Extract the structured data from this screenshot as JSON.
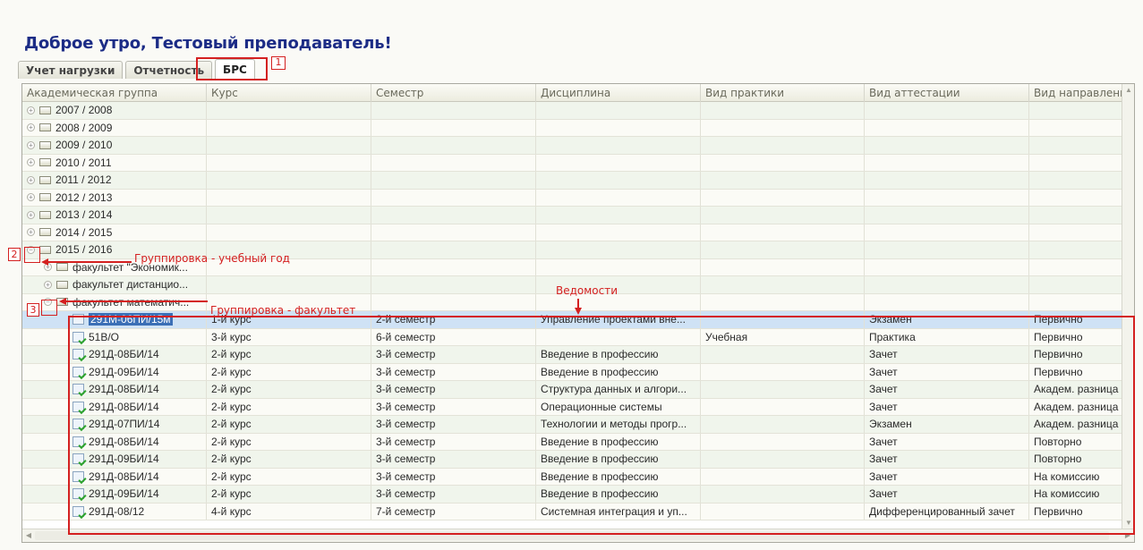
{
  "greeting": "Доброе утро, Тестовый преподаватель!",
  "tabs": [
    {
      "label": "Учет нагрузки",
      "active": false
    },
    {
      "label": "Отчетность",
      "active": false
    },
    {
      "label": "БРС",
      "active": true
    }
  ],
  "columns": [
    "Академическая группа",
    "Курс",
    "Семестр",
    "Дисциплина",
    "Вид практики",
    "Вид аттестации",
    "Вид направления"
  ],
  "year_rows": [
    "2007 / 2008",
    "2008 / 2009",
    "2009 / 2010",
    "2010 / 2011",
    "2011 / 2012",
    "2012 / 2013",
    "2013 / 2014",
    "2014 / 2015"
  ],
  "expanded_year": "2015 / 2016",
  "faculties": [
    "факультет \"Экономик...",
    "факультет дистанцио...",
    "факультет математич..."
  ],
  "records": [
    {
      "group": "291М-06ПИ/15м",
      "course": "1-й курс",
      "semester": "2-й семестр",
      "discipline": "Управление проектами вне...",
      "practice": "",
      "attestation": "Экзамен",
      "direction": "Первично"
    },
    {
      "group": "51В/О",
      "course": "3-й курс",
      "semester": "6-й семестр",
      "discipline": "",
      "practice": "Учебная",
      "attestation": "Практика",
      "direction": "Первично"
    },
    {
      "group": "291Д-08БИ/14",
      "course": "2-й курс",
      "semester": "3-й семестр",
      "discipline": "Введение в профессию",
      "practice": "",
      "attestation": "Зачет",
      "direction": "Первично"
    },
    {
      "group": "291Д-09БИ/14",
      "course": "2-й курс",
      "semester": "3-й семестр",
      "discipline": "Введение в профессию",
      "practice": "",
      "attestation": "Зачет",
      "direction": "Первично"
    },
    {
      "group": "291Д-08БИ/14",
      "course": "2-й курс",
      "semester": "3-й семестр",
      "discipline": "Структура данных и алгори...",
      "practice": "",
      "attestation": "Зачет",
      "direction": "Академ. разница"
    },
    {
      "group": "291Д-08БИ/14",
      "course": "2-й курс",
      "semester": "3-й семестр",
      "discipline": "Операционные системы",
      "practice": "",
      "attestation": "Зачет",
      "direction": "Академ. разница"
    },
    {
      "group": "291Д-07ПИ/14",
      "course": "2-й курс",
      "semester": "3-й семестр",
      "discipline": "Технологии и методы прогр...",
      "practice": "",
      "attestation": "Экзамен",
      "direction": "Академ. разница"
    },
    {
      "group": "291Д-08БИ/14",
      "course": "2-й курс",
      "semester": "3-й семестр",
      "discipline": "Введение в профессию",
      "practice": "",
      "attestation": "Зачет",
      "direction": "Повторно"
    },
    {
      "group": "291Д-09БИ/14",
      "course": "2-й курс",
      "semester": "3-й семестр",
      "discipline": "Введение в профессию",
      "practice": "",
      "attestation": "Зачет",
      "direction": "Повторно"
    },
    {
      "group": "291Д-08БИ/14",
      "course": "2-й курс",
      "semester": "3-й семестр",
      "discipline": "Введение в профессию",
      "practice": "",
      "attestation": "Зачет",
      "direction": "На комиссию"
    },
    {
      "group": "291Д-09БИ/14",
      "course": "2-й курс",
      "semester": "3-й семестр",
      "discipline": "Введение в профессию",
      "practice": "",
      "attestation": "Зачет",
      "direction": "На комиссию"
    },
    {
      "group": "291Д-08/12",
      "course": "4-й курс",
      "semester": "7-й семестр",
      "discipline": "Системная интеграция и уп...",
      "practice": "",
      "attestation": "Дифференцированный зачет",
      "direction": "Первично"
    }
  ],
  "annotations": {
    "tab_marker": "1",
    "year_marker": "2",
    "faculty_marker": "3",
    "year_grouping": "Группировка - учебный год",
    "faculty_grouping": "Группировка - факультет",
    "statements": "Ведомости"
  },
  "colors": {
    "annotation": "#d42020",
    "greeting": "#1c2c86",
    "selected_row": "#cfe2f5"
  }
}
